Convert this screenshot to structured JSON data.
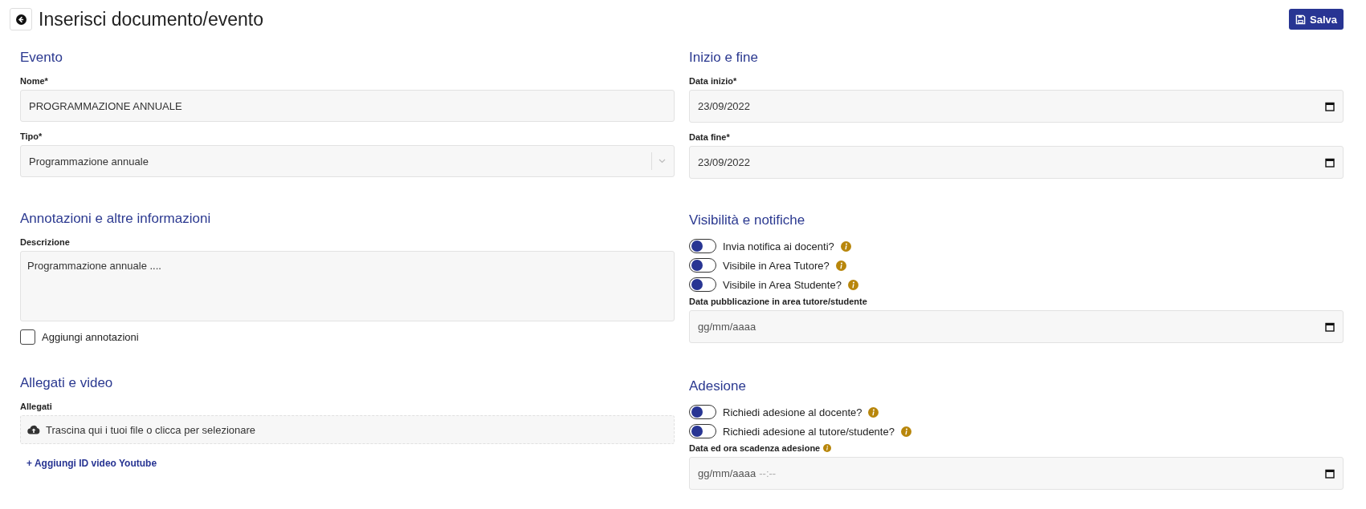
{
  "header": {
    "title": "Inserisci documento/evento",
    "save_button": "Salva"
  },
  "left": [
    {
      "title": "Evento",
      "items": [
        {
          "kind": "text",
          "label": "Nome*",
          "value": "PROGRAMMAZIONE ANNUALE"
        },
        {
          "kind": "select",
          "label": "Tipo*",
          "value": "Programmazione annuale"
        }
      ]
    },
    {
      "title": "Annotazioni e altre informazioni",
      "items": [
        {
          "kind": "textarea",
          "label": "Descrizione",
          "value": "Programmazione annuale ...."
        },
        {
          "kind": "checkbox",
          "label": "Aggiungi annotazioni",
          "checked": false
        }
      ]
    },
    {
      "title": "Allegati e video",
      "items": [
        {
          "kind": "dropzone",
          "label": "Allegati",
          "hint": "Trascina qui i tuoi file o clicca per selezionare"
        },
        {
          "kind": "link",
          "text": "+ Aggiungi ID video Youtube"
        }
      ]
    }
  ],
  "right": [
    {
      "title": "Inizio e fine",
      "items": [
        {
          "kind": "date",
          "label": "Data inizio*",
          "value": "23/09/2022"
        },
        {
          "kind": "date",
          "label": "Data fine*",
          "value": "23/09/2022"
        }
      ]
    },
    {
      "title": "Visibilità e notifiche",
      "items": [
        {
          "kind": "toggle",
          "label": "Invia notifica ai docenti?",
          "on": false,
          "info": true
        },
        {
          "kind": "toggle",
          "label": "Visibile in Area Tutore?",
          "on": false,
          "info": true
        },
        {
          "kind": "toggle",
          "label": "Visibile in Area Studente?",
          "on": false,
          "info": true
        },
        {
          "kind": "date",
          "label": "Data pubblicazione in area tutore/studente",
          "placeholder": "gg/mm/aaaa"
        }
      ]
    },
    {
      "title": "Adesione",
      "items": [
        {
          "kind": "toggle",
          "label": "Richiedi adesione al docente?",
          "on": false,
          "info": true
        },
        {
          "kind": "toggle",
          "label": "Richiedi adesione al tutore/studente?",
          "on": false,
          "info": true
        },
        {
          "kind": "date",
          "label": "Data ed ora scadenza adesione",
          "info": true,
          "placeholder": "gg/mm/aaaa",
          "time_placeholder": "--:--"
        }
      ]
    }
  ]
}
